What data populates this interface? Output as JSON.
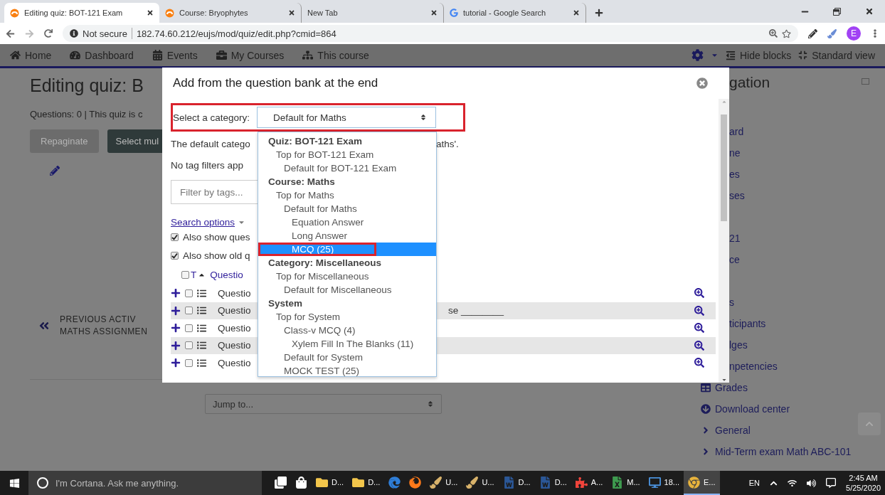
{
  "browser": {
    "tabs": [
      {
        "title": "Editing quiz: BOT-121 Exam",
        "kind": "moodle",
        "selected": true
      },
      {
        "title": "Course: Bryophytes",
        "kind": "moodle",
        "selected": false
      },
      {
        "title": "New Tab",
        "kind": "blank",
        "selected": false
      },
      {
        "title": "tutorial - Google Search",
        "kind": "google",
        "selected": false
      }
    ],
    "security": "Not secure",
    "url": "182.74.60.212/eujs/mod/quiz/edit.php?cmid=864",
    "profile": "E"
  },
  "navbar": {
    "items": [
      {
        "label": "Home",
        "kind": "home"
      },
      {
        "label": "Dashboard",
        "kind": "dashboard"
      },
      {
        "label": "Events",
        "kind": "calendar"
      },
      {
        "label": "My Courses",
        "kind": "courses"
      },
      {
        "label": "This course",
        "kind": "course"
      }
    ],
    "hide_blocks": "Hide blocks",
    "standard_view": "Standard view"
  },
  "page": {
    "heading": "Editing quiz: B",
    "info": "Questions: 0 | This quiz is c",
    "buttons": [
      {
        "label": "Repaginate",
        "disabled": true
      },
      {
        "label": "Select mul",
        "disabled": false
      }
    ],
    "previous": {
      "line1": "PREVIOUS ACTIV",
      "line2": "MATHS ASSIGNMEN"
    },
    "jump": {
      "value": "Jump to..."
    }
  },
  "sidebar": {
    "heading": "gation",
    "covered_groups": [
      [
        "ard",
        "ne",
        "es",
        "ses"
      ],
      [
        "21",
        "ce"
      ],
      [
        "s",
        "ticipants",
        "lges",
        "npetencies"
      ]
    ],
    "items": [
      {
        "label": "Grades",
        "kind": "report"
      },
      {
        "label": "Download center",
        "kind": "download"
      },
      {
        "label": "General",
        "kind": "section"
      },
      {
        "label": "Mid-Term exam Math ABC-101",
        "kind": "section"
      }
    ]
  },
  "modal": {
    "title": "Add from the question bank at the end",
    "category": {
      "label": "Select a category:",
      "value": "Default for Maths",
      "highlighted": true
    },
    "default_text": {
      "start": "The default catego",
      "end": "aths'."
    },
    "tag_text": "No tag filters app",
    "filter": {
      "placeholder": "Filter by tags..."
    },
    "search_options": "Search options",
    "options": [
      {
        "label": "Also show ques",
        "checked": true
      },
      {
        "label": "Also show old q",
        "checked": true
      }
    ],
    "table": {
      "type_column": "T",
      "question_column": "Questio",
      "header_checked": false,
      "rows": [
        {
          "name": "Questio",
          "text": "",
          "checked": false
        },
        {
          "name": "Questio",
          "text": "se ________",
          "checked": false
        },
        {
          "name": "Questio",
          "text": "",
          "checked": false
        },
        {
          "name": "Questio",
          "text": "",
          "checked": false
        },
        {
          "name": "Questio",
          "text": "",
          "checked": false
        }
      ]
    },
    "dropdown": [
      {
        "label": "Quiz: BOT-121 Exam",
        "kind": "group",
        "children": [
          {
            "label": "Top for BOT-121 Exam",
            "kind": "option",
            "selected": false,
            "children": [
              {
                "label": "Default for BOT-121 Exam",
                "kind": "option",
                "selected": false
              }
            ]
          }
        ]
      },
      {
        "label": "Course: Maths",
        "kind": "group",
        "children": [
          {
            "label": "Top for Maths",
            "kind": "option",
            "selected": false,
            "children": [
              {
                "label": "Default for Maths",
                "kind": "option",
                "selected": false,
                "children": [
                  {
                    "label": "Equation Answer",
                    "kind": "option",
                    "selected": false
                  },
                  {
                    "label": "Long Answer",
                    "kind": "option",
                    "selected": false
                  },
                  {
                    "label": "MCQ (25)",
                    "kind": "option",
                    "selected": true,
                    "highlighted": true
                  }
                ]
              }
            ]
          }
        ]
      },
      {
        "label": "Category: Miscellaneous",
        "kind": "group",
        "children": [
          {
            "label": "Top for Miscellaneous",
            "kind": "option",
            "selected": false,
            "children": [
              {
                "label": "Default for Miscellaneous",
                "kind": "option",
                "selected": false
              }
            ]
          }
        ]
      },
      {
        "label": "System",
        "kind": "group",
        "children": [
          {
            "label": "Top for System",
            "kind": "option",
            "selected": false,
            "children": [
              {
                "label": "Class-v MCQ (4)",
                "kind": "option",
                "selected": false,
                "children": [
                  {
                    "label": "Xylem Fill In The Blanks (11)",
                    "kind": "option",
                    "selected": false
                  }
                ]
              },
              {
                "label": "Default for System",
                "kind": "option",
                "selected": false
              },
              {
                "label": "MOCK TEST (25)",
                "kind": "option",
                "selected": false
              }
            ]
          }
        ]
      }
    ]
  },
  "taskbar": {
    "search": "I'm Cortana. Ask me anything.",
    "apps": [
      {
        "kind": "taskview",
        "selected": false
      },
      {
        "kind": "store",
        "selected": false
      },
      {
        "kind": "folder",
        "label": "D...",
        "selected": false
      },
      {
        "kind": "folder",
        "label": "D...",
        "selected": false
      },
      {
        "kind": "edge",
        "selected": false
      },
      {
        "kind": "firefox",
        "selected": false
      },
      {
        "kind": "paint",
        "label": "U...",
        "selected": false
      },
      {
        "kind": "paint",
        "label": "U...",
        "selected": false
      },
      {
        "kind": "word",
        "label": "D...",
        "selected": false
      },
      {
        "kind": "word",
        "label": "D...",
        "selected": false
      },
      {
        "kind": "anydesk",
        "label": "A...",
        "selected": false
      },
      {
        "kind": "sheet",
        "label": "M...",
        "selected": false
      },
      {
        "kind": "pc",
        "label": "18...",
        "selected": false
      },
      {
        "kind": "chrome",
        "label": "E...",
        "selected": true
      }
    ],
    "language": "EN",
    "time": "2:45 AM",
    "date": "5/25/2020"
  }
}
